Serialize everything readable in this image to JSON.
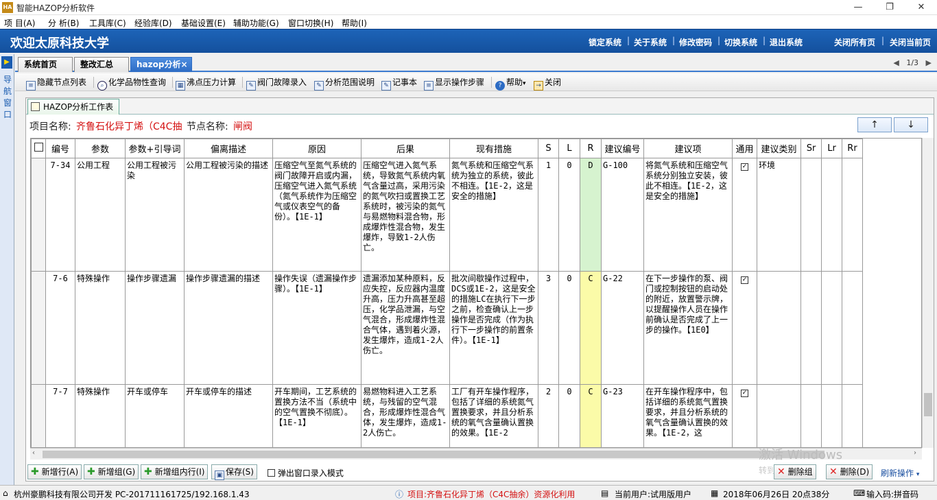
{
  "window": {
    "title": "智能HAZOP分析软件",
    "icon_text": "HA"
  },
  "menu": [
    "项 目(A)",
    "分 析(B)",
    "工具库(C)",
    "经验库(D)",
    "基础设置(E)",
    "辅助功能(G)",
    "窗口切换(H)",
    "帮助(I)"
  ],
  "header": {
    "welcome": "欢迎太原科技大学",
    "links": [
      "锁定系统",
      "关于系统",
      "修改密码",
      "切换系统",
      "退出系统"
    ],
    "right_links": [
      "关闭所有页",
      "关闭当前页"
    ]
  },
  "leftnav": {
    "chars": [
      "导",
      "航",
      "窗",
      "口"
    ]
  },
  "tabs": {
    "items": [
      "系统首页",
      "整改汇总",
      "hazop分析"
    ],
    "active": 2,
    "close": "×",
    "pager": "1/3"
  },
  "toolbar": [
    "隐藏节点列表",
    "化学品物性查询",
    "沸点压力计算",
    "阀门故障录入",
    "分析范围说明",
    "记事本",
    "显示操作步骤",
    "帮助",
    "关闭"
  ],
  "subtab": "HAZOP分析工作表",
  "project": {
    "name_label": "项目名称:",
    "name_value": "齐鲁石化异丁烯（C4C抽",
    "node_label": "节点名称:",
    "node_value": "闸阀"
  },
  "nav_buttons": {
    "up": "↑",
    "down": "↓"
  },
  "columns": [
    "编号",
    "参数",
    "参数+引导词",
    "偏离描述",
    "原因",
    "后果",
    "现有措施",
    "S",
    "L",
    "R",
    "建议编号",
    "建议项",
    "通用",
    "建议类别",
    "Sr",
    "Lr",
    "Rr"
  ],
  "rows": [
    {
      "id": "7-34",
      "param": "公用工程",
      "param_guide": "公用工程被污染",
      "deviation": "公用工程被污染的描述",
      "cause": "压缩空气至氮气系统的阀门故障开启或内漏，压缩空气进入氮气系统（氮气系统作为压缩空气或仪表空气的备份）。【1E-1】",
      "consequence": "压缩空气进入氮气系统，导致氮气系统内氧气含量过高，采用污染的氮气吹扫或置换工艺系统时，被污染的氮气与易燃物料混合物，形成爆炸性混合物，发生爆炸，导致1-2人伤亡。",
      "measures": "氮气系统和压缩空气系统为独立的系统，彼此不相连。【1E-2，这是安全的措施】",
      "S": "1",
      "L": "0",
      "R": "D",
      "sug_id": "G-100",
      "suggestion": "将氮气系统和压缩空气系统分别独立安装，彼此不相连。【1E-2，这是安全的措施】",
      "general": "✓",
      "category": "环境",
      "Sr": "",
      "Lr": "",
      "Rr": ""
    },
    {
      "id": "7-6",
      "param": "特殊操作",
      "param_guide": "操作步骤遗漏",
      "deviation": "操作步骤遗漏的描述",
      "cause": "操作失误（遗漏操作步骤）。【1E-1】",
      "consequence": "遗漏添加某种原料，反应失控，反应器内温度升高，压力升高甚至超压，化学品泄漏，与空气混合，形成爆炸性混合气体，遇到着火源，发生爆炸，造成1-2人伤亡。",
      "measures": "批次间歇操作过程中，DCS或1E-2，这是安全的措施LC在执行下一步之前，检查确认上一步操作是否完成（作为执行下一步操作的前置条件）。【1E-1】",
      "S": "3",
      "L": "0",
      "R": "C",
      "sug_id": "G-22",
      "suggestion": "在下一步操作的泵、阀门或控制按钮的启动处的附近，放置警示牌，以提醒操作人员在操作前确认是否完成了上一步的操作。【1E0】",
      "general": "✓",
      "category": "",
      "Sr": "",
      "Lr": "",
      "Rr": ""
    },
    {
      "id": "7-7",
      "param": "特殊操作",
      "param_guide": "开车或停车",
      "deviation": "开车或停车的描述",
      "cause": "开车期间，工艺系统的置换方法不当（系统中的空气置换不彻底）。【1E-1】",
      "consequence": "易燃物料进入工艺系统，与残留的空气混合，形成爆炸性混合气体，发生爆炸，造成1-2人伤亡。",
      "measures": "工厂有开车操作程序，包括了详细的系统氮气置换要求，并且分析系统的氧气含量确认置换的效果。【1E-2",
      "S": "2",
      "L": "0",
      "R": "C",
      "sug_id": "G-23",
      "suggestion": "在开车操作程序中，包括详细的系统氮气置换要求，并且分析系统的氧气含量确认置换的效果。【1E-2，这",
      "general": "✓",
      "category": "",
      "Sr": "",
      "Lr": "",
      "Rr": ""
    }
  ],
  "bottom": {
    "add_row": "新增行(A)",
    "add_group": "新增组(G)",
    "add_inner_row": "新增组内行(I)",
    "save": "保存(S)",
    "popup_mode": "弹出窗口录入模式",
    "delete_group": "删除组",
    "delete": "删除(D)",
    "refresh": "刷新操作"
  },
  "watermark": {
    "line1": "激活 Windows",
    "line2": "转到"
  },
  "status": {
    "company": "杭州豪鹏科技有限公司开发  PC-201711161725/192.168.1.43",
    "project": "项目:齐鲁石化异丁烯（C4C抽余）资源化利用",
    "user": "当前用户:试用版用户",
    "datetime": "2018年06月26日 20点38分",
    "ime": "输入码:拼音码"
  }
}
